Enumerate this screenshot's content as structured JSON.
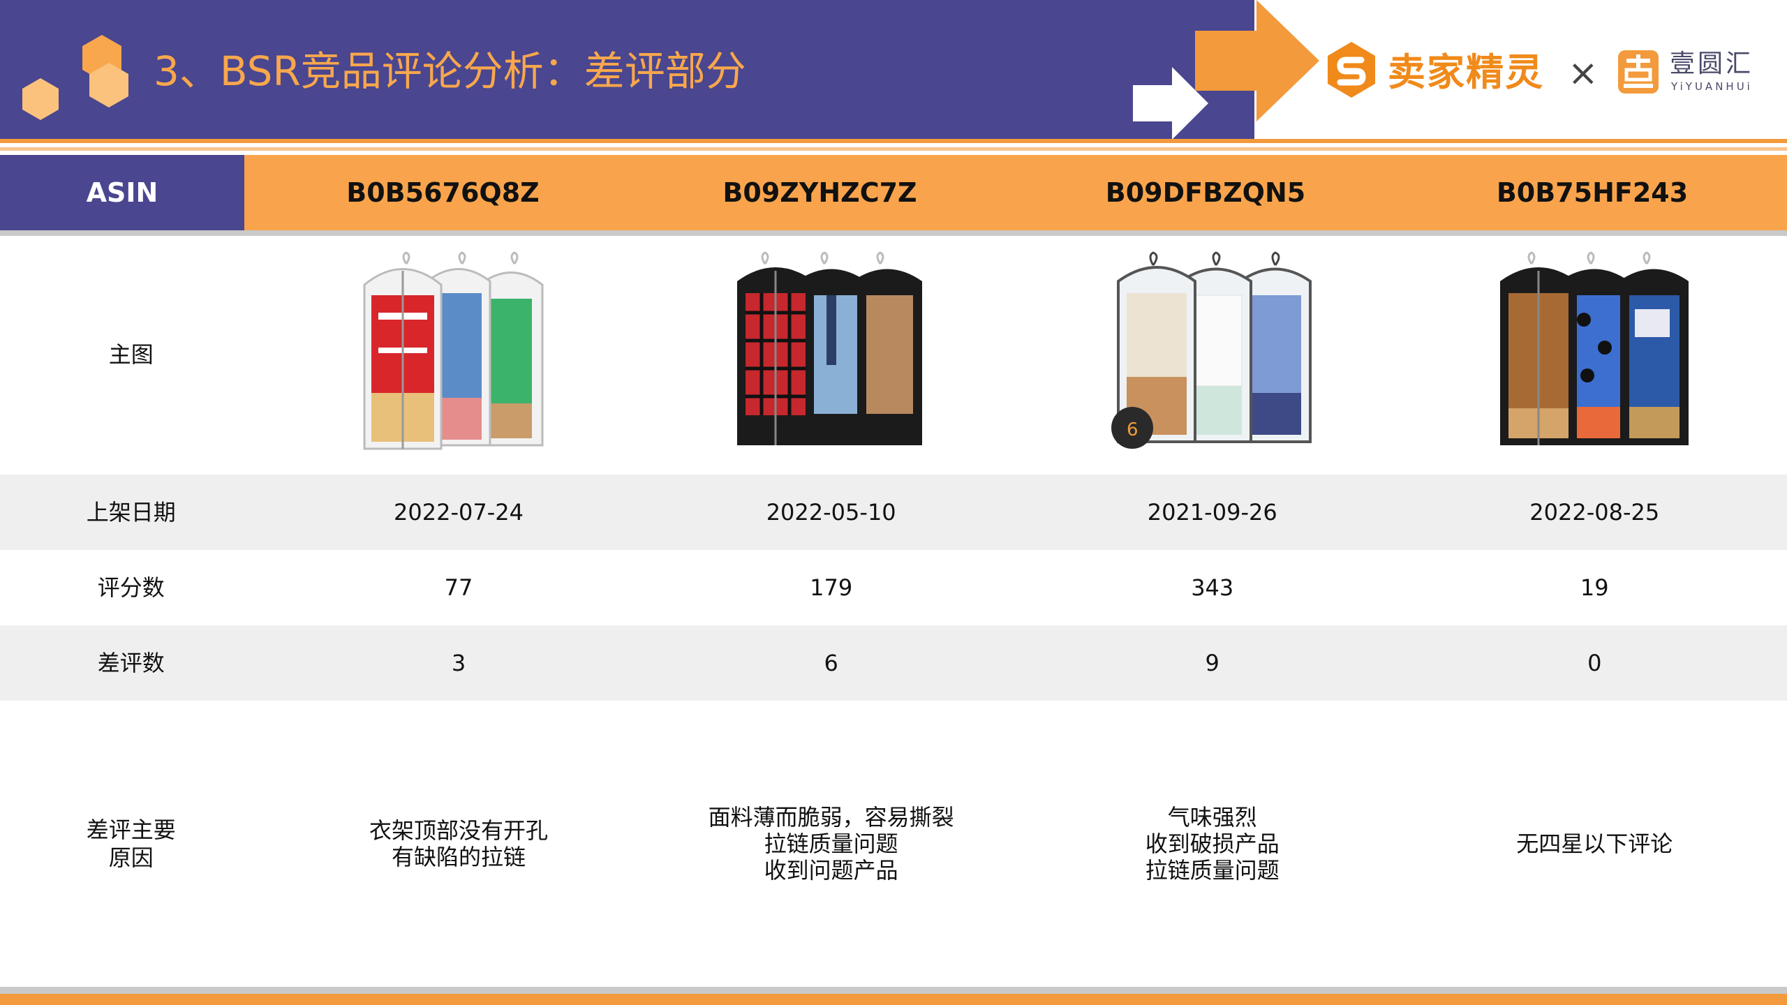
{
  "header": {
    "title": "3、BSR竞品评论分析：差评部分",
    "brand_name": "卖家精灵",
    "cross": "×",
    "partner_name_cn": "壹圆汇",
    "partner_name_en": "YiYUANHUi"
  },
  "colors": {
    "header_band": "#4a468f",
    "accent_orange": "#f39a3c",
    "table_head_orange": "#f9a44c",
    "title_orange": "#f8a74d",
    "row_gray": "#efefef"
  },
  "table": {
    "header_label": "ASIN",
    "asins": [
      "B0B5676Q8Z",
      "B09ZYHZC7Z",
      "B09DFBZQN5",
      "B0B75HF243"
    ],
    "rows": {
      "main_image": {
        "label": "主图",
        "images": [
          "garment-bags-colorful-icon",
          "garment-bags-black-icon",
          "garment-bags-clear-icon",
          "garment-bags-leather-icon"
        ]
      },
      "listing_date": {
        "label": "上架日期",
        "values": [
          "2022-07-24",
          "2022-05-10",
          "2021-09-26",
          "2022-08-25"
        ]
      },
      "rating_count": {
        "label": "评分数",
        "values": [
          "77",
          "179",
          "343",
          "19"
        ]
      },
      "negative_count": {
        "label": "差评数",
        "values": [
          "3",
          "6",
          "9",
          "0"
        ]
      },
      "negative_reasons": {
        "label_line1": "差评主要",
        "label_line2": "原因",
        "values": [
          [
            "衣架顶部没有开孔",
            "有缺陷的拉链"
          ],
          [
            "面料薄而脆弱，容易撕裂",
            "拉链质量问题",
            "收到问题产品"
          ],
          [
            "气味强烈",
            "收到破损产品",
            "拉链质量问题"
          ],
          [
            "无四星以下评论"
          ]
        ]
      }
    }
  }
}
